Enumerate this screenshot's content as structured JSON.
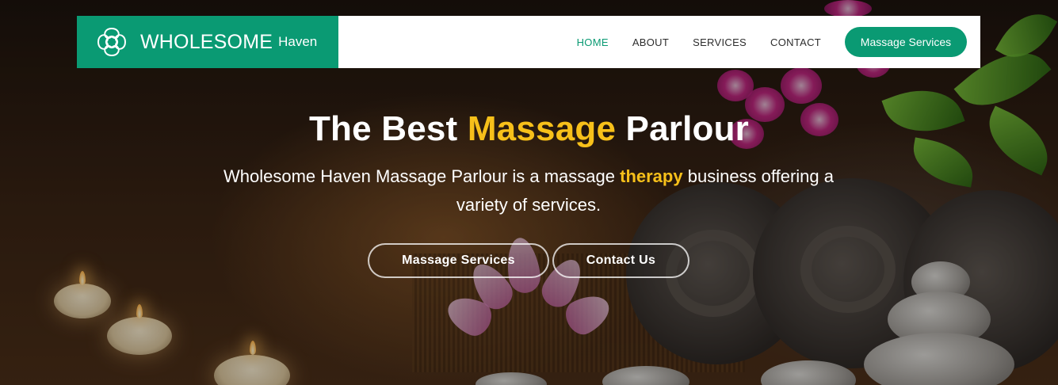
{
  "brand": {
    "name": "WHOLESOME",
    "sub": "Haven",
    "logo_icon": "celtic-knot-icon",
    "color": "#0a9a73"
  },
  "nav": {
    "items": [
      {
        "label": "HOME",
        "active": true
      },
      {
        "label": "ABOUT",
        "active": false
      },
      {
        "label": "SERVICES",
        "active": false
      },
      {
        "label": "CONTACT",
        "active": false
      }
    ],
    "cta_label": "Massage Services"
  },
  "hero": {
    "title_pre": "The Best ",
    "title_highlight": "Massage",
    "title_post": " Parlour",
    "text_pre": "Wholesome Haven Massage Parlour is a massage ",
    "text_highlight": "therapy",
    "text_post": " business offering a variety of services.",
    "highlight_color": "#f7c01a",
    "buttons": [
      {
        "label": "Massage Services"
      },
      {
        "label": "Contact Us"
      }
    ]
  }
}
